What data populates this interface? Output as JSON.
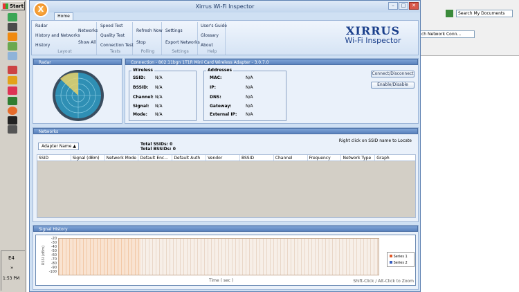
{
  "taskbar": {
    "start_label": "Start",
    "clock": "1:53 PM",
    "tray_label": "E4"
  },
  "background_window": {
    "search_placeholder": "Search My Documents",
    "network_label": "ch Network Conn..."
  },
  "window": {
    "title": "Xirrus Wi-Fi Inspector",
    "logo_letter": "X",
    "home_tab": "Home"
  },
  "ribbon": {
    "layout": {
      "items": [
        "Radar",
        "History and Networks",
        "History",
        "Networks",
        "Show All"
      ],
      "label": "Layout"
    },
    "tests": {
      "items": [
        "Speed Test",
        "Quality Test",
        "Connection Test"
      ],
      "label": "Tests"
    },
    "polling": {
      "items": [
        "Refresh Now",
        "Stop"
      ],
      "label": "Polling"
    },
    "settings": {
      "items": [
        "Settings",
        "Export Networks"
      ],
      "label": "Settings"
    },
    "help": {
      "items": [
        "User's Guide",
        "Glossary",
        "About"
      ],
      "label": "Help"
    }
  },
  "brand": {
    "line1": "XIRRUS",
    "line2": "Wi-Fi Inspector"
  },
  "radar": {
    "header": "Radar"
  },
  "connection": {
    "header": "Connection - 802.11bgn 1T1R Mini Card Wireless Adapter - 3.0.7.0",
    "wireless_legend": "Wireless",
    "wireless": [
      {
        "k": "SSID:",
        "v": "N/A"
      },
      {
        "k": "BSSID:",
        "v": "N/A"
      },
      {
        "k": "Channel:",
        "v": "N/A"
      },
      {
        "k": "Signal:",
        "v": "N/A"
      },
      {
        "k": "Mode:",
        "v": "N/A"
      }
    ],
    "addresses_legend": "Addresses",
    "addresses": [
      {
        "k": "MAC:",
        "v": "N/A"
      },
      {
        "k": "IP:",
        "v": "N/A"
      },
      {
        "k": "DNS:",
        "v": "N/A"
      },
      {
        "k": "Gateway:",
        "v": "N/A"
      },
      {
        "k": "External IP:",
        "v": "N/A"
      }
    ],
    "connect_btn": "Connect/Disconnect",
    "enable_btn": "Enable/Disable"
  },
  "networks": {
    "header": "Networks",
    "hint": "Right click on SSID name to Locate",
    "adapter_name": "Adapter Name",
    "total_ssids": "Total SSIDs: 0",
    "total_bssids": "Total BSSIDs: 0",
    "columns": [
      "SSID",
      "Signal (dBm)",
      "Network Mode",
      "Default Enc...",
      "Default Auth",
      "Vendor",
      "BSSID",
      "Channel",
      "Frequency",
      "Network Type",
      "Graph"
    ]
  },
  "signal": {
    "header": "Signal History",
    "y_label": "RSSI (dBm)",
    "y_ticks": [
      "-20",
      "-30",
      "-40",
      "-50",
      "-60",
      "-70",
      "-80",
      "-90",
      "-100"
    ],
    "x_label": "Time ( sec )",
    "zoom_hint": "Shift-Click / Alt-Click to Zoom",
    "legend": [
      {
        "name": "Series 1",
        "color": "#e05a2a"
      },
      {
        "name": "Series 2",
        "color": "#3a5fbf"
      }
    ]
  }
}
